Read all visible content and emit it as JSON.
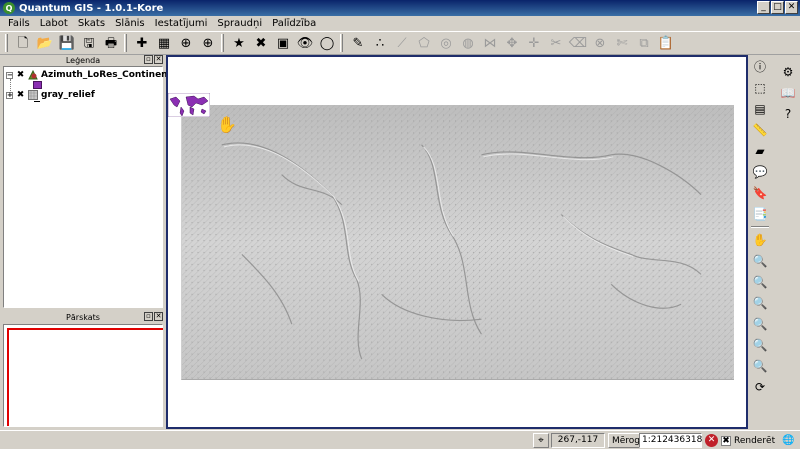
{
  "window": {
    "title": "Quantum GIS - 1.0.1-Kore",
    "app_icon_letter": "Q",
    "minimize_glyph": "_",
    "maximize_glyph": "□",
    "close_glyph": "✕"
  },
  "menu": [
    "Fails",
    "Labot",
    "Skats",
    "Slānis",
    "Iestatījumi",
    "Spraudņi",
    "Palīdzība"
  ],
  "toolbar": {
    "icons": [
      {
        "name": "new-project-icon",
        "glyph": "🗋"
      },
      {
        "name": "open-project-icon",
        "glyph": "📂"
      },
      {
        "name": "save-project-icon",
        "glyph": "💾"
      },
      {
        "name": "save-as-icon",
        "glyph": "🖫"
      },
      {
        "name": "print-icon",
        "glyph": "🖶"
      },
      {
        "name": "add-vector-layer-icon",
        "glyph": "✚"
      },
      {
        "name": "add-raster-layer-icon",
        "glyph": "▦"
      },
      {
        "name": "add-postgis-layer-icon",
        "glyph": "⊕"
      },
      {
        "name": "add-wms-layer-icon",
        "glyph": "⊕"
      },
      {
        "name": "show-all-layers-icon",
        "glyph": "★"
      },
      {
        "name": "remove-layer-icon",
        "glyph": "✖"
      },
      {
        "name": "overview-icon",
        "glyph": "▣"
      },
      {
        "name": "show-hide-icon",
        "glyph": "👁"
      },
      {
        "name": "hide-all-icon",
        "glyph": "◯"
      },
      {
        "name": "toggle-editing-icon",
        "glyph": "✎"
      },
      {
        "name": "capture-point-icon",
        "glyph": "∴"
      },
      {
        "name": "capture-line-icon",
        "glyph": "⟋"
      },
      {
        "name": "capture-polygon-icon",
        "glyph": "⬠"
      },
      {
        "name": "add-ring-icon",
        "glyph": "◎"
      },
      {
        "name": "add-island-icon",
        "glyph": "◍"
      },
      {
        "name": "move-vertex-icon",
        "glyph": "⋈"
      },
      {
        "name": "add-vertex-icon",
        "glyph": "✥"
      },
      {
        "name": "move-feature-icon",
        "glyph": "✛"
      },
      {
        "name": "split-feature-icon",
        "glyph": "✂"
      },
      {
        "name": "delete-vertex-icon",
        "glyph": "⌫"
      },
      {
        "name": "delete-selected-icon",
        "glyph": "⊗"
      },
      {
        "name": "cut-features-icon",
        "glyph": "✄"
      },
      {
        "name": "copy-features-icon",
        "glyph": "⧉"
      },
      {
        "name": "paste-features-icon",
        "glyph": "📋"
      }
    ]
  },
  "legend": {
    "title": "Leģenda",
    "layers": [
      {
        "name": "Azimuth_LoRes_Continents",
        "checked": "✖",
        "expander": "−"
      },
      {
        "name": "gray_relief",
        "checked": "✖",
        "expander": "+"
      }
    ]
  },
  "overview": {
    "title": "Pārskats"
  },
  "dock_buttons": {
    "float": "▫",
    "close": "✕"
  },
  "right_toolbar": [
    {
      "name": "identify-icon",
      "glyph": "ⓘ"
    },
    {
      "name": "select-features-icon",
      "glyph": "⬚"
    },
    {
      "name": "attribute-table-icon",
      "glyph": "▤"
    },
    {
      "name": "measure-line-icon",
      "glyph": "📏"
    },
    {
      "name": "measure-area-icon",
      "glyph": "▰"
    },
    {
      "name": "map-tips-icon",
      "glyph": "💬"
    },
    {
      "name": "new-bookmark-icon",
      "glyph": "🔖"
    },
    {
      "name": "show-bookmarks-icon",
      "glyph": "📑"
    },
    {
      "name": "pan-icon",
      "glyph": "✋"
    },
    {
      "name": "zoom-in-icon",
      "glyph": "🔍"
    },
    {
      "name": "zoom-out-icon",
      "glyph": "🔍"
    },
    {
      "name": "zoom-full-icon",
      "glyph": "🔍"
    },
    {
      "name": "zoom-to-selection-icon",
      "glyph": "🔍"
    },
    {
      "name": "zoom-to-layer-icon",
      "glyph": "🔍"
    },
    {
      "name": "zoom-last-icon",
      "glyph": "🔍"
    },
    {
      "name": "refresh-icon",
      "glyph": "⟳"
    }
  ],
  "right_toolbar2": [
    {
      "name": "plugin-icon",
      "glyph": "⚙"
    },
    {
      "name": "help-icon",
      "glyph": "📖"
    },
    {
      "name": "whats-this-icon",
      "glyph": "?"
    }
  ],
  "status": {
    "coordinates": "267,-117",
    "scale_label": "Mērogs",
    "scale_value": "1:212436318",
    "stop_glyph": "✕",
    "render_label": "Renderēt",
    "render_checked": "✖"
  }
}
